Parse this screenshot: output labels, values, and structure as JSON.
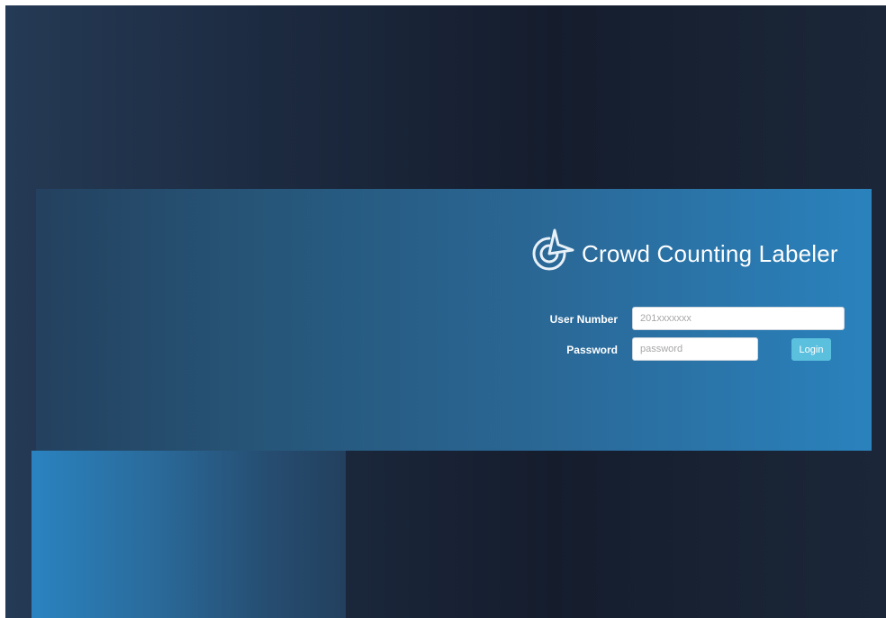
{
  "app": {
    "title": "Crowd Counting Labeler",
    "logo_icon": "target-arrow-logo-icon"
  },
  "login_form": {
    "user_number_label": "User Number",
    "user_number_value": "",
    "user_number_placeholder": "201xxxxxxx",
    "password_label": "Password",
    "password_value": "",
    "password_placeholder": "password",
    "login_label": "Login"
  },
  "colors": {
    "background_dark": "#151d2d",
    "banner_light": "#2a82bd",
    "banner_dark": "#24415f",
    "login_button": "#5bc0de",
    "text": "#ffffff"
  }
}
